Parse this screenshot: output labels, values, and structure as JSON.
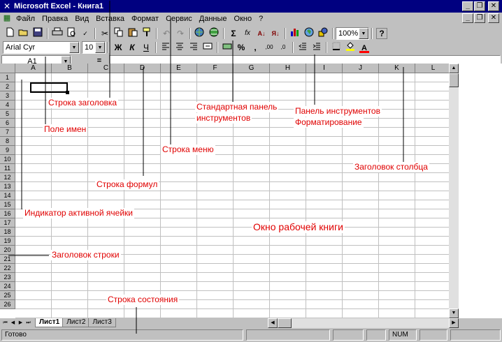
{
  "window": {
    "title": "Microsoft Excel - Книга1",
    "app_icon": "excel-x-icon",
    "buttons": {
      "minimize": "_",
      "restore": "❐",
      "close": "✕"
    }
  },
  "menubar": {
    "doc_icon": "workbook-icon",
    "items": [
      "Файл",
      "Правка",
      "Вид",
      "Вставка",
      "Формат",
      "Сервис",
      "Данные",
      "Окно",
      "?"
    ]
  },
  "standard_toolbar": {
    "zoom": "100%",
    "icons": [
      "new-icon",
      "open-icon",
      "save-icon",
      "print-icon",
      "print-preview-icon",
      "spelling-icon",
      "cut-icon",
      "copy-icon",
      "paste-icon",
      "format-painter-icon",
      "undo-icon",
      "redo-icon",
      "hyperlink-icon",
      "web-toolbar-icon",
      "autosum-icon",
      "function-icon",
      "sort-ascending-icon",
      "sort-descending-icon",
      "chart-wizard-icon",
      "map-icon",
      "drawing-icon",
      "help-icon"
    ],
    "glyphs": {
      "autosum": "Σ",
      "function": "fx",
      "sort_asc": "А↓",
      "sort_desc": "Я↓",
      "help": "?"
    }
  },
  "formatting_toolbar": {
    "font": "Arial Cyr",
    "size": "10",
    "bold": "Ж",
    "italic": "К",
    "underline": "Ч",
    "percent": "%",
    "comma": ",",
    "inc_decimal": ",00",
    "dec_decimal": ",0",
    "font_color_glyph": "A"
  },
  "formula_bar": {
    "name_box": "A1",
    "equals": "=",
    "content": ""
  },
  "grid": {
    "columns": [
      "A",
      "B",
      "C",
      "D",
      "E",
      "F",
      "G",
      "H",
      "I",
      "J",
      "K",
      "L"
    ],
    "rows": [
      "1",
      "2",
      "3",
      "4",
      "5",
      "6",
      "7",
      "8",
      "9",
      "10",
      "11",
      "12",
      "13",
      "14",
      "15",
      "16",
      "17",
      "18",
      "19",
      "20",
      "21",
      "22",
      "23",
      "24",
      "25",
      "26"
    ]
  },
  "sheet_tabs": [
    "Лист1",
    "Лист2",
    "Лист3"
  ],
  "statusbar": {
    "ready": "Готово",
    "num": "NUM"
  },
  "annotations": {
    "title_row": "Строка заголовка",
    "name_field": "Поле имен",
    "standard_panel_line1": "Стандартная панель",
    "standard_panel_line2": "инструментов",
    "format_panel_line1": "Панель инструментов",
    "format_panel_line2": "Форматирование",
    "menu_row": "Строка меню",
    "column_header": "Заголовок столбца",
    "formula_row": "Строка формул",
    "active_cell": "Индикатор активной ячейки",
    "workbook_window": "Окно рабочей книги",
    "row_header": "Заголовок строки",
    "status_row": "Строка состояния"
  },
  "colors": {
    "annotation": "#e00000",
    "titlebar": "#000080",
    "chrome": "#c0c0c0"
  }
}
